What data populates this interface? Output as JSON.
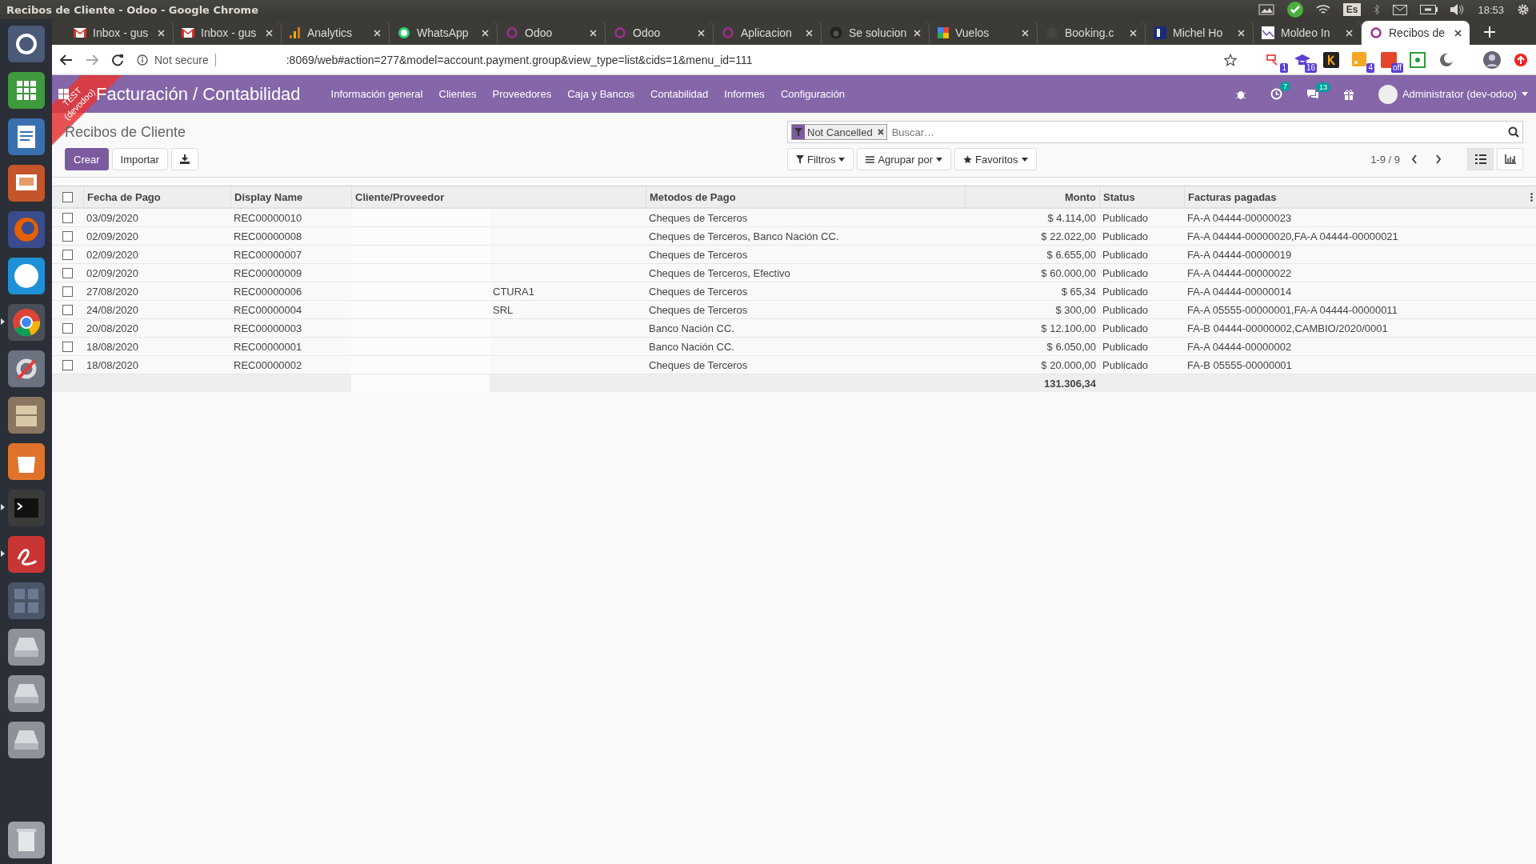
{
  "window": {
    "title": "Recibos de Cliente - Odoo - Google Chrome"
  },
  "system_tray": {
    "keyboard": "Es",
    "time": "18:53"
  },
  "launcher": [
    {
      "kind": "dash",
      "running": false
    },
    {
      "kind": "calc",
      "running": false
    },
    {
      "kind": "writer",
      "running": false
    },
    {
      "kind": "impress",
      "running": false
    },
    {
      "kind": "firefox",
      "running": false
    },
    {
      "kind": "skype",
      "running": false
    },
    {
      "kind": "chrome",
      "running": true
    },
    {
      "kind": "settings",
      "running": false
    },
    {
      "kind": "archive",
      "running": false
    },
    {
      "kind": "store",
      "running": false
    },
    {
      "kind": "terminal",
      "running": true
    },
    {
      "kind": "viewer",
      "running": true
    },
    {
      "kind": "workspaces",
      "running": false
    },
    {
      "kind": "drive",
      "running": false
    },
    {
      "kind": "drive",
      "running": false
    },
    {
      "kind": "drive",
      "running": false
    },
    {
      "kind": "trash",
      "running": false
    }
  ],
  "tabs": [
    {
      "title": "Inbox - gus",
      "kind": "gmail",
      "selected": false
    },
    {
      "title": "Inbox - gus",
      "kind": "gmail",
      "selected": false
    },
    {
      "title": "Analytics",
      "kind": "analytics",
      "selected": false
    },
    {
      "title": "WhatsApp",
      "kind": "whatsapp",
      "selected": false
    },
    {
      "title": "Odoo",
      "kind": "odoo",
      "selected": false
    },
    {
      "title": "Odoo",
      "kind": "odoo",
      "selected": false
    },
    {
      "title": "Aplicacion",
      "kind": "odoo",
      "selected": false
    },
    {
      "title": "Se solucion",
      "kind": "github",
      "selected": false
    },
    {
      "title": "Vuelos",
      "kind": "google",
      "selected": false
    },
    {
      "title": "Booking.c",
      "kind": "blank",
      "selected": false
    },
    {
      "title": "Michel Ho",
      "kind": "booking",
      "selected": false
    },
    {
      "title": "Moldeo In",
      "kind": "moldeo",
      "selected": false
    },
    {
      "title": "Recibos de",
      "kind": "odoo",
      "selected": true
    }
  ],
  "address_bar": {
    "security": "Not secure",
    "url": ":8069/web#action=277&model=account.payment.group&view_type=list&cids=1&menu_id=111"
  },
  "extensions": [
    {
      "kind": "cast",
      "badge": "1"
    },
    {
      "kind": "cap",
      "badge": "16"
    },
    {
      "kind": "k"
    },
    {
      "kind": "rss",
      "badge": "4"
    },
    {
      "kind": "grid",
      "badge": "off"
    },
    {
      "kind": "help"
    },
    {
      "kind": "moon"
    }
  ],
  "navbar": {
    "app_title": "Facturación / Contabilidad",
    "menus": [
      "Información general",
      "Clientes",
      "Proveedores",
      "Caja y Bancos",
      "Contabilidad",
      "Informes",
      "Configuración"
    ],
    "activity_count": "7",
    "message_count": "13",
    "user": "Administrator (dev-odoo)"
  },
  "ribbon": {
    "lines": [
      "TEST",
      "(devodoo)"
    ]
  },
  "control_panel": {
    "breadcrumb": "Recibos de Cliente",
    "create_button": "Crear",
    "import_button": "Importar",
    "search": {
      "facet": "Not Cancelled",
      "placeholder": "Buscar…"
    },
    "dropdowns": [
      {
        "kind": "filter",
        "label": "Filtros"
      },
      {
        "kind": "group",
        "label": "Agrupar por"
      },
      {
        "kind": "star",
        "label": "Favoritos"
      }
    ],
    "pager": "1-9 / 9",
    "views": [
      {
        "kind": "list",
        "selected": true
      },
      {
        "kind": "graph",
        "selected": false
      }
    ]
  },
  "table": {
    "header_checked": false,
    "columns": [
      "Fecha de Pago",
      "Display Name",
      "Cliente/Proveedor",
      "Metodos de Pago",
      "Monto",
      "Status",
      "Facturas pagadas"
    ],
    "rows": [
      {
        "checked": false,
        "cells": [
          "03/09/2020",
          "REC00000010",
          "",
          "Cheques de Terceros",
          "$ 4.114,00",
          "Publicado",
          "FA-A 04444-00000023"
        ]
      },
      {
        "checked": false,
        "cells": [
          "02/09/2020",
          "REC00000008",
          "",
          "Cheques de Terceros, Banco Nación CC.",
          "$ 22.022,00",
          "Publicado",
          "FA-A 04444-00000020,FA-A 04444-00000021"
        ]
      },
      {
        "checked": false,
        "cells": [
          "02/09/2020",
          "REC00000007",
          "",
          "Cheques de Terceros",
          "$ 6.655,00",
          "Publicado",
          "FA-A 04444-00000019"
        ]
      },
      {
        "checked": false,
        "cells": [
          "02/09/2020",
          "REC00000009",
          "",
          "Cheques de Terceros, Efectivo",
          "$ 60.000,00",
          "Publicado",
          "FA-A 04444-00000022"
        ]
      },
      {
        "checked": false,
        "cells": [
          "27/08/2020",
          "REC00000006",
          "CTURA1",
          "Cheques de Terceros",
          "$ 65,34",
          "Publicado",
          "FA-A 04444-00000014"
        ]
      },
      {
        "checked": false,
        "cells": [
          "24/08/2020",
          "REC00000004",
          "SRL",
          "Cheques de Terceros",
          "$ 300,00",
          "Publicado",
          "FA-A 05555-00000001,FA-A 04444-00000011"
        ]
      },
      {
        "checked": false,
        "cells": [
          "20/08/2020",
          "REC00000003",
          "",
          "Banco Nación CC.",
          "$ 12.100,00",
          "Publicado",
          "FA-B 04444-00000002,CAMBIO/2020/0001"
        ]
      },
      {
        "checked": false,
        "cells": [
          "18/08/2020",
          "REC00000001",
          "",
          "Banco Nación CC.",
          "$ 6.050,00",
          "Publicado",
          "FA-A 04444-00000002"
        ]
      },
      {
        "checked": false,
        "cells": [
          "18/08/2020",
          "REC00000002",
          "",
          "Cheques de Terceros",
          "$ 20.000,00",
          "Publicado",
          "FA-B 05555-00000001"
        ]
      }
    ],
    "total": "131.306,34"
  }
}
